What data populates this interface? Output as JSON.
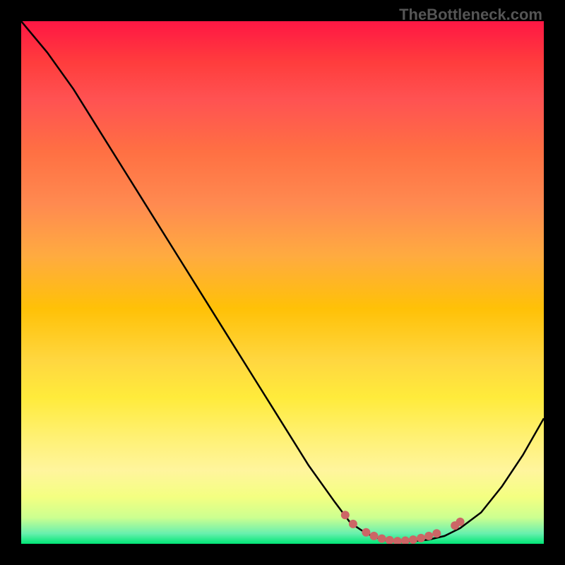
{
  "watermark": "TheBottleneck.com",
  "chart_data": {
    "type": "line",
    "title": "",
    "xlabel": "",
    "ylabel": "",
    "x_range": [
      0,
      100
    ],
    "y_range": [
      0,
      100
    ],
    "series": [
      {
        "name": "curve",
        "x": [
          0,
          5,
          10,
          15,
          20,
          25,
          30,
          35,
          40,
          45,
          50,
          55,
          60,
          63,
          66,
          69,
          72,
          75,
          78,
          81,
          84,
          88,
          92,
          96,
          100
        ],
        "y": [
          100,
          94,
          87,
          79,
          71,
          63,
          55,
          47,
          39,
          31,
          23,
          15,
          8,
          4,
          2,
          0.8,
          0.3,
          0.5,
          0.8,
          1.5,
          3,
          6,
          11,
          17,
          24
        ]
      }
    ],
    "highlight_dots": {
      "name": "optimal-range",
      "color": "#cc6666",
      "points": [
        {
          "x": 62,
          "y": 5.5
        },
        {
          "x": 63.5,
          "y": 3.8
        },
        {
          "x": 66,
          "y": 2.2
        },
        {
          "x": 67.5,
          "y": 1.5
        },
        {
          "x": 69,
          "y": 1.0
        },
        {
          "x": 70.5,
          "y": 0.7
        },
        {
          "x": 72,
          "y": 0.5
        },
        {
          "x": 73.5,
          "y": 0.6
        },
        {
          "x": 75,
          "y": 0.8
        },
        {
          "x": 76.5,
          "y": 1.1
        },
        {
          "x": 78,
          "y": 1.5
        },
        {
          "x": 79.5,
          "y": 2.0
        },
        {
          "x": 83,
          "y": 3.5
        },
        {
          "x": 84,
          "y": 4.2
        }
      ]
    },
    "gradient_colors": {
      "top": "#ff1744",
      "middle": "#ffeb3b",
      "bottom": "#00e676"
    }
  }
}
